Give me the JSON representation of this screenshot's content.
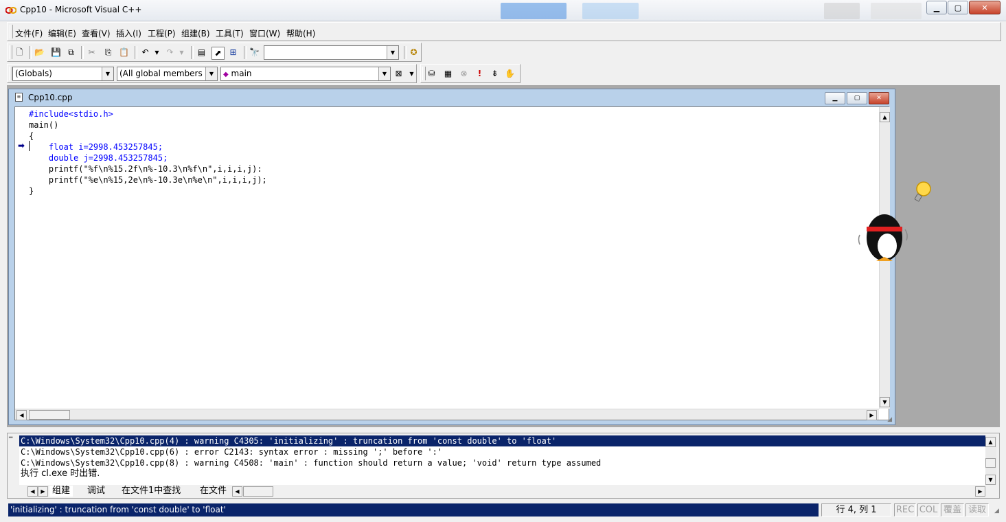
{
  "window": {
    "title": "Cpp10 - Microsoft Visual C++"
  },
  "menu": [
    "文件(F)",
    "编辑(E)",
    "查看(V)",
    "插入(I)",
    "工程(P)",
    "组建(B)",
    "工具(T)",
    "窗口(W)",
    "帮助(H)"
  ],
  "toolbar": {
    "find_value": ""
  },
  "wizardbar": {
    "class": "(Globals)",
    "filter": "(All global members",
    "member": "main"
  },
  "editor": {
    "title": "Cpp10.cpp",
    "lines": [
      "#include<stdio.h>",
      "main()",
      "{",
      "    float i=2998.453257845;",
      "    double j=2998.453257845;",
      "    printf(\"%f\\n%15.2f\\n%-10.3\\n%f\\n\",i,i,i,j):",
      "    printf(\"%e\\n%15,2e\\n%-10.3e\\n%e\\n\",i,i,i,j);",
      "}"
    ]
  },
  "output": {
    "lines": [
      "C:\\Windows\\System32\\Cpp10.cpp(4) : warning C4305: 'initializing' : truncation from 'const double' to 'float'",
      "C:\\Windows\\System32\\Cpp10.cpp(6) : error C2143: syntax error : missing ';' before ':'",
      "C:\\Windows\\System32\\Cpp10.cpp(8) : warning C4508: 'main' : function should return a value; 'void' return type assumed",
      "执行 cl.exe 时出错."
    ],
    "tabs": [
      "组建",
      "调试",
      "在文件1中查找",
      "在文件"
    ]
  },
  "status": {
    "message": "'initializing' : truncation from 'const double' to 'float'",
    "position": "行 4, 列 1",
    "rec": "REC",
    "col": "COL",
    "ovr": "覆盖",
    "read": "读取"
  },
  "colors": {
    "selection": "#0a246a",
    "keyword": "#0000ff",
    "mdi_background": "#a9a9a9"
  }
}
